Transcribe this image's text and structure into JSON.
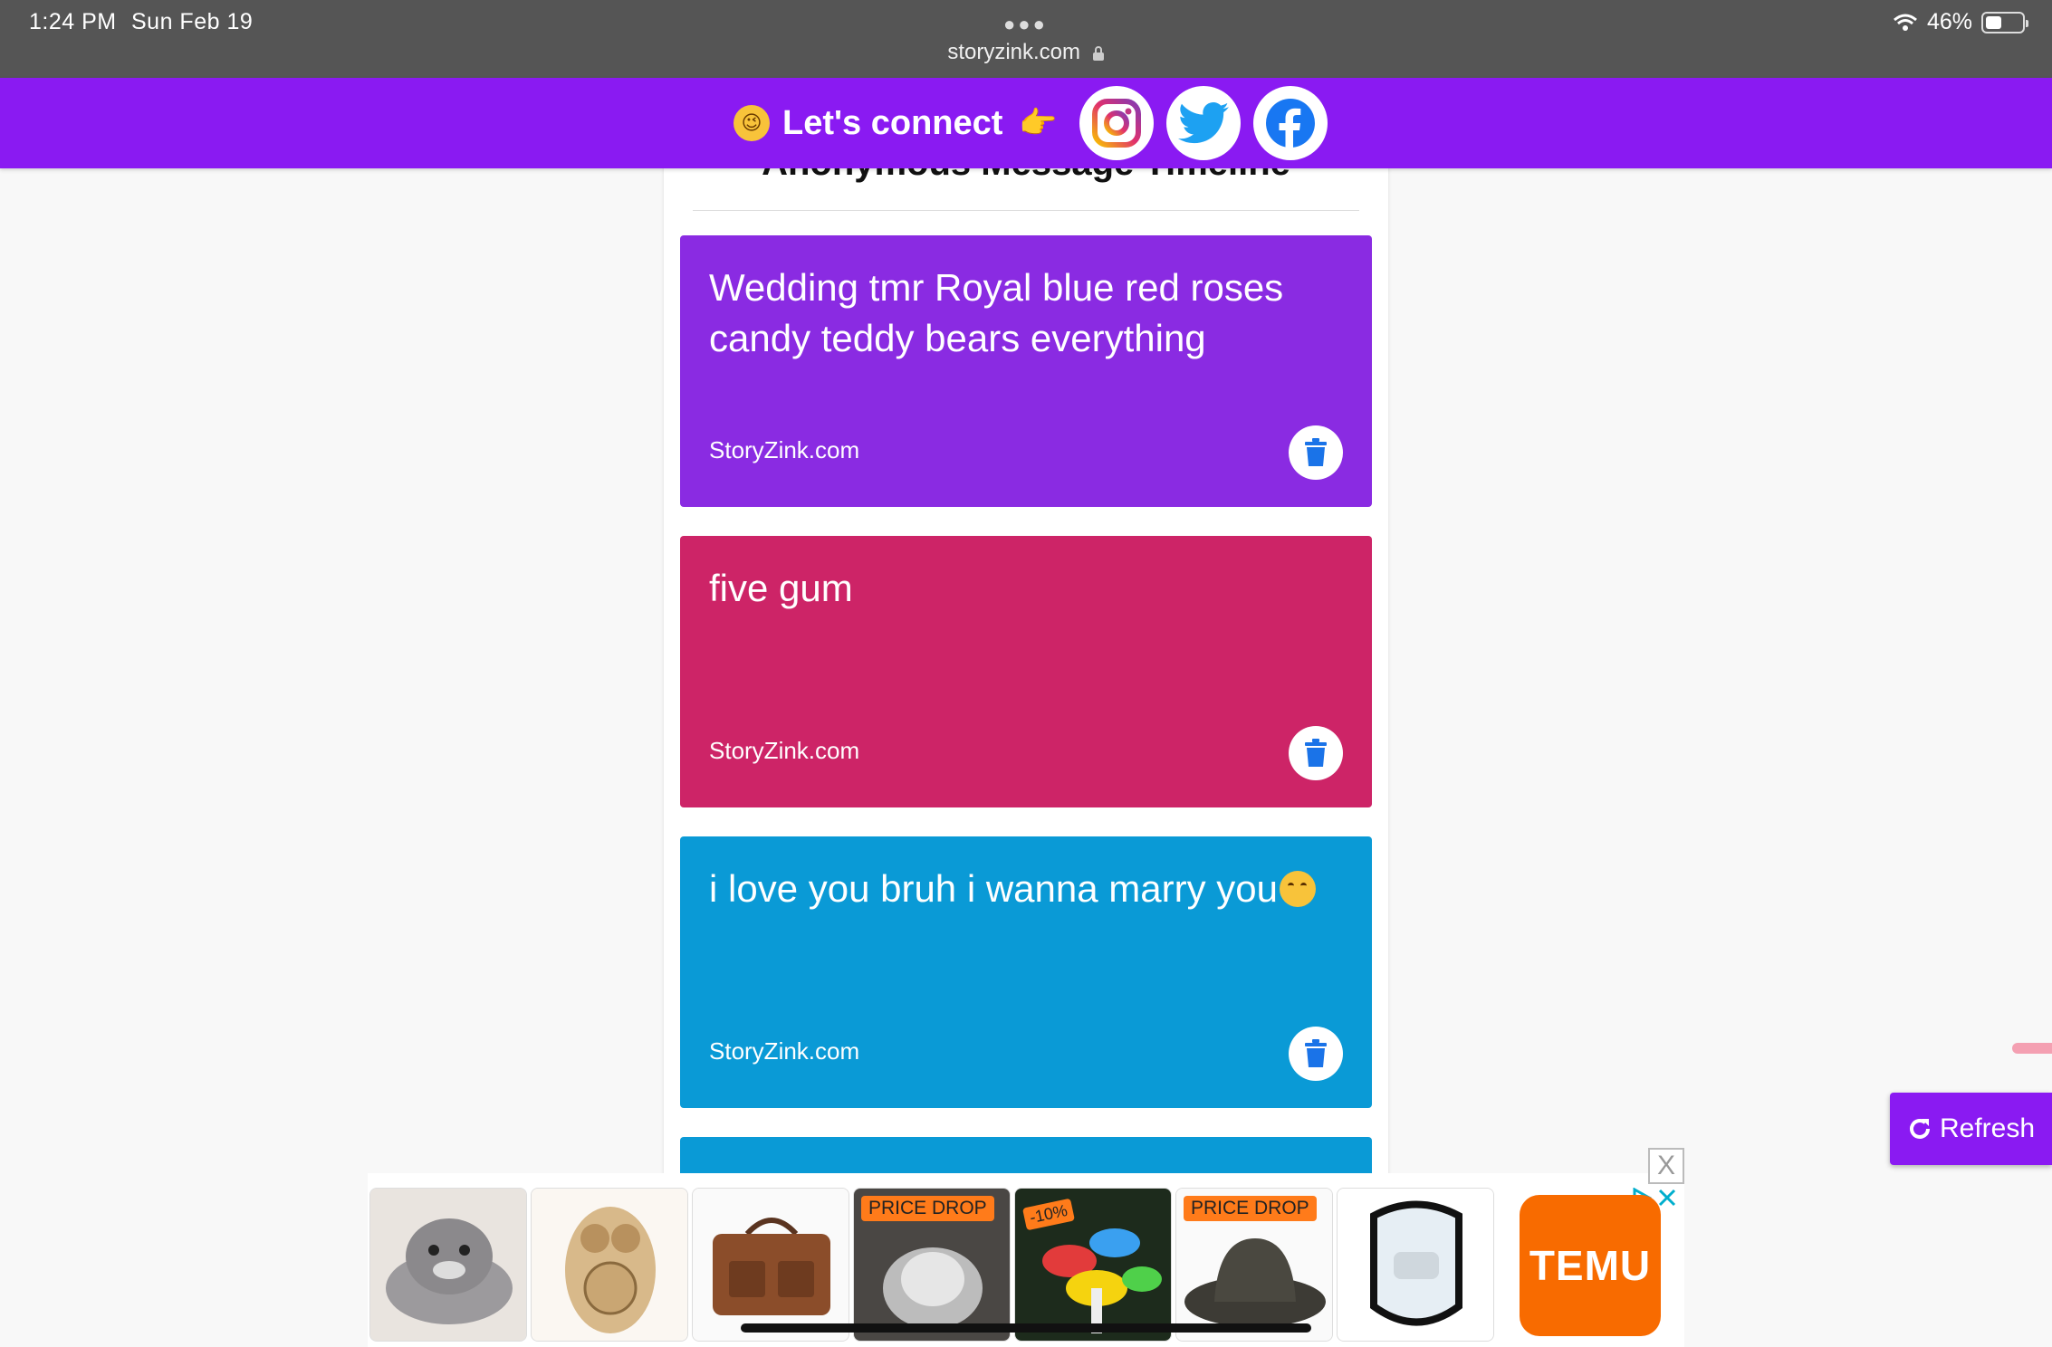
{
  "status_bar": {
    "time": "1:24 PM",
    "date": "Sun Feb 19",
    "battery": "46%",
    "battery_level": 0.46,
    "url": "storyzink.com"
  },
  "connect_bar": {
    "text": "Let's connect",
    "socials": [
      "instagram-icon",
      "twitter-icon",
      "facebook-icon"
    ]
  },
  "panel": {
    "title": "Anonymous Message Timeline"
  },
  "messages": [
    {
      "text": "Wedding tmr Royal blue red roses candy teddy bears everything",
      "site": "StoryZink.com",
      "color": "#8a2be2"
    },
    {
      "text": "five gum",
      "site": "StoryZink.com",
      "color": "#cd2467"
    },
    {
      "text": "i love you bruh i wanna marry you",
      "site": "StoryZink.com",
      "color": "#0a9ad6"
    },
    {
      "text": "",
      "site": "",
      "color": "#0a9ad6"
    }
  ],
  "refresh": {
    "label": "Refresh"
  },
  "ad": {
    "close_label": "X",
    "badges": [
      "PRICE DROP",
      "-10%",
      "PRICE DROP"
    ],
    "brand": "TEMU"
  }
}
